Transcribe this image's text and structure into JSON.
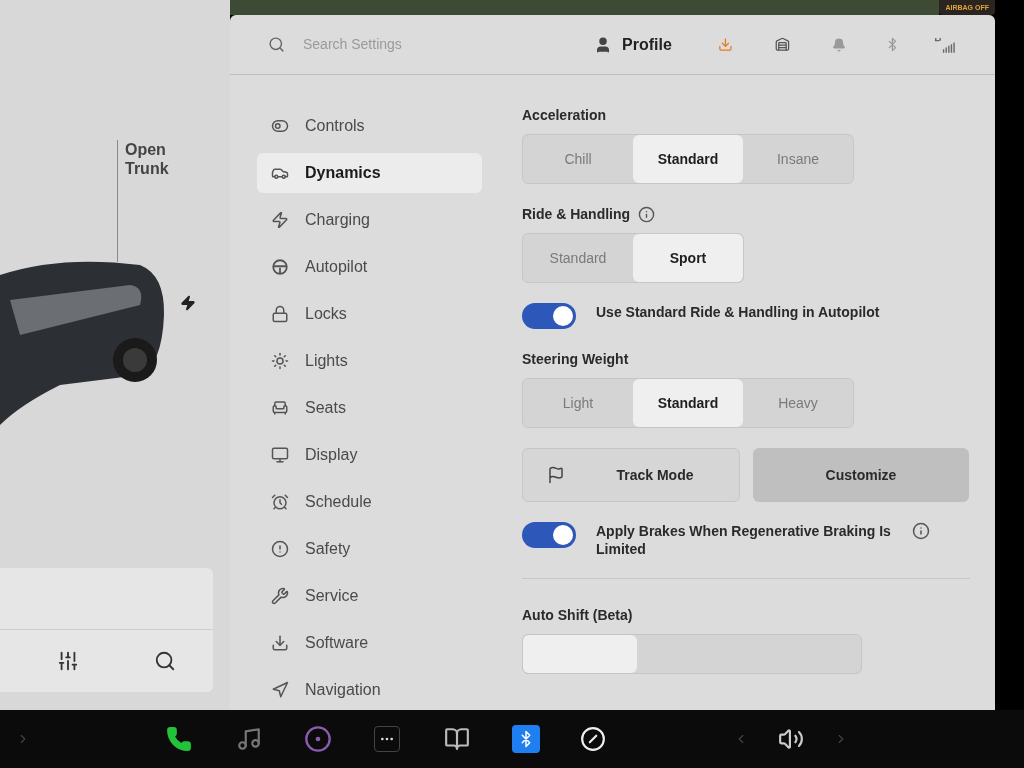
{
  "status_badge": "AIRBAG OFF",
  "car_panel": {
    "trunk_label": "Open Trunk"
  },
  "header": {
    "search": {
      "placeholder": "Search Settings"
    },
    "profile": "Profile"
  },
  "sidebar": {
    "items": [
      {
        "label": "Controls",
        "selected": false
      },
      {
        "label": "Dynamics",
        "selected": true
      },
      {
        "label": "Charging",
        "selected": false
      },
      {
        "label": "Autopilot",
        "selected": false
      },
      {
        "label": "Locks",
        "selected": false
      },
      {
        "label": "Lights",
        "selected": false
      },
      {
        "label": "Seats",
        "selected": false
      },
      {
        "label": "Display",
        "selected": false
      },
      {
        "label": "Schedule",
        "selected": false
      },
      {
        "label": "Safety",
        "selected": false
      },
      {
        "label": "Service",
        "selected": false
      },
      {
        "label": "Software",
        "selected": false
      },
      {
        "label": "Navigation",
        "selected": false
      }
    ]
  },
  "settings": [
    {
      "kind": "segmented",
      "title": "Acceleration",
      "info": false,
      "options": [
        {
          "label": "Chill",
          "selected": false
        },
        {
          "label": "Standard",
          "selected": true
        },
        {
          "label": "Insane",
          "selected": false
        }
      ]
    },
    {
      "kind": "segmented",
      "title": "Ride & Handling",
      "info": true,
      "options": [
        {
          "label": "Standard",
          "selected": false
        },
        {
          "label": "Sport",
          "selected": true
        }
      ]
    },
    {
      "kind": "toggle",
      "label": "Use Standard Ride & Handling in Autopilot",
      "on": true,
      "info": false
    },
    {
      "kind": "segmented",
      "title": "Steering Weight",
      "info": false,
      "options": [
        {
          "label": "Light",
          "selected": false
        },
        {
          "label": "Standard",
          "selected": true
        },
        {
          "label": "Heavy",
          "selected": false
        }
      ]
    },
    {
      "kind": "buttons",
      "buttons": [
        "Track Mode",
        "Customize"
      ]
    },
    {
      "kind": "toggle",
      "label": "Apply Brakes When Regenerative Braking Is Limited",
      "on": true,
      "info": true
    },
    {
      "kind": "heading",
      "title": "Auto Shift (Beta)"
    }
  ]
}
